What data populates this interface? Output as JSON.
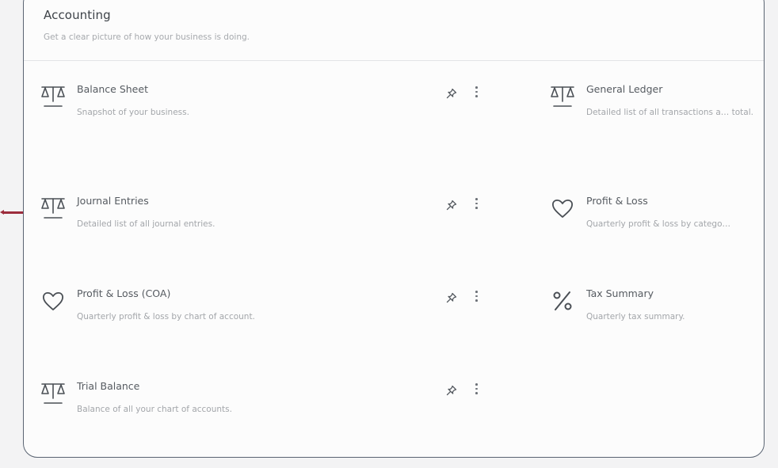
{
  "section": {
    "title": "Accounting",
    "subtitle": "Get a clear picture of how your business is doing."
  },
  "reports": [
    {
      "name": "Balance Sheet",
      "description": "Snapshot of your business.",
      "icon": "scale-icon",
      "pinnable": true
    },
    {
      "name": "General Ledger",
      "description": "Detailed list of all transactions a… total.",
      "icon": "scale-icon",
      "pinnable": false
    },
    {
      "name": "Journal Entries",
      "description": "Detailed list of all journal entries.",
      "icon": "scale-icon",
      "pinnable": true
    },
    {
      "name": "Profit & Loss",
      "description": "Quarterly profit & loss by catego…",
      "icon": "heart-icon",
      "pinnable": false
    },
    {
      "name": "Profit & Loss (COA)",
      "description": "Quarterly profit & loss by chart of account.",
      "icon": "heart-icon",
      "pinnable": true
    },
    {
      "name": "Tax Summary",
      "description": "Quarterly tax summary.",
      "icon": "percent-icon",
      "pinnable": false
    },
    {
      "name": "Trial Balance",
      "description": "Balance of all your chart of accounts.",
      "icon": "scale-icon",
      "pinnable": true
    }
  ],
  "colors": {
    "card_border": "#5a6472",
    "arrow": "#9c2c3c",
    "text_primary": "#565b61",
    "text_muted": "#a3a6aa"
  }
}
